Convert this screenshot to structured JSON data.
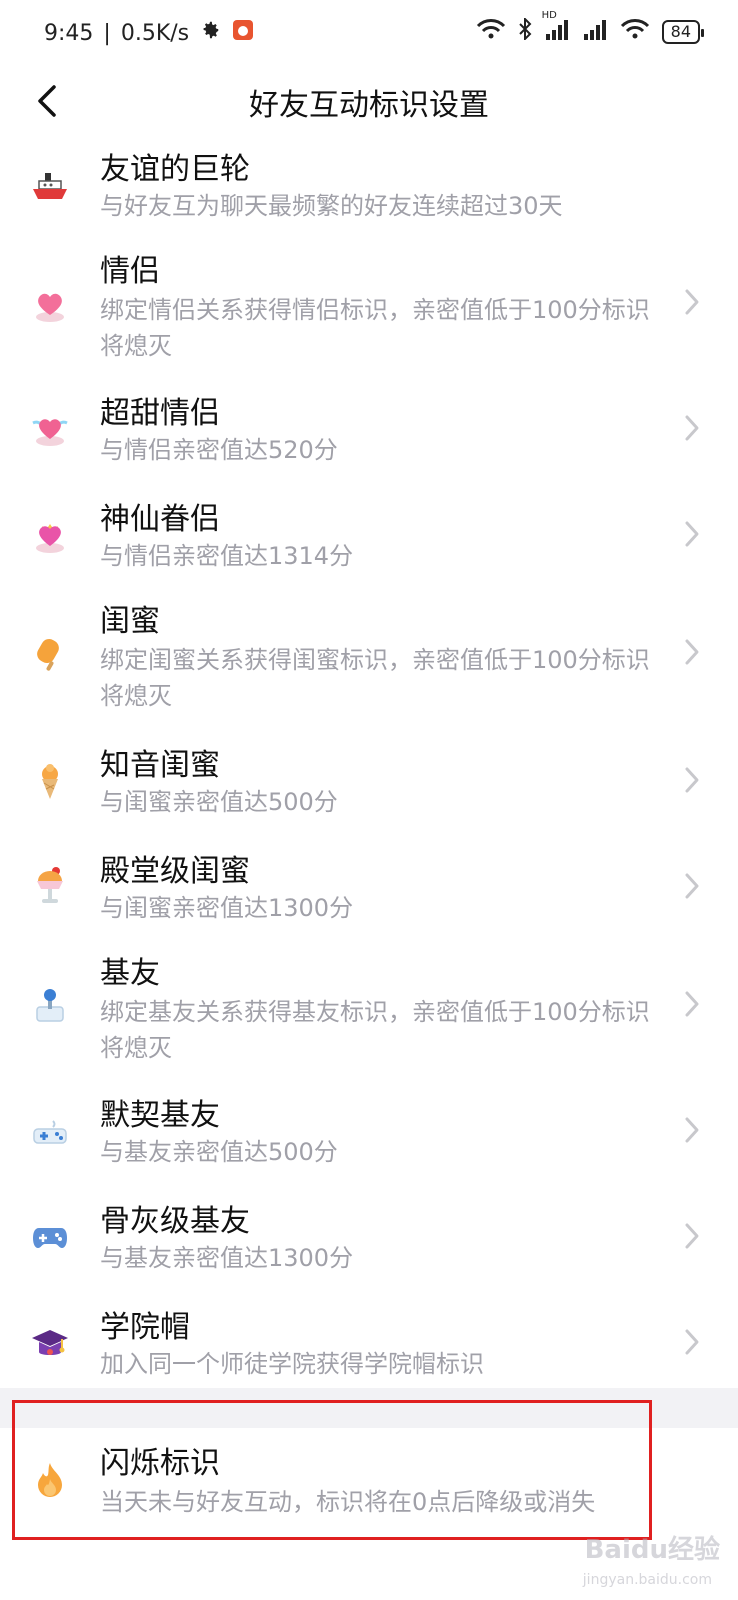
{
  "status": {
    "time": "9:45",
    "speed": "0.5K/s",
    "battery": "84",
    "hd_label": "HD"
  },
  "header": {
    "title": "好友互动标识设置"
  },
  "items": [
    {
      "title": "友谊的巨轮",
      "desc": "与好友互为聊天最频繁的好友连续超过30天",
      "icon": "ship-icon",
      "has_chevron": false
    },
    {
      "title": "情侣",
      "desc": "绑定情侣关系获得情侣标识，亲密值低于100分标识将熄灭",
      "icon": "heart-icon"
    },
    {
      "title": "超甜情侣",
      "desc": "与情侣亲密值达520分",
      "icon": "winged-heart-icon"
    },
    {
      "title": "神仙眷侣",
      "desc": "与情侣亲密值达1314分",
      "icon": "crowned-heart-icon"
    },
    {
      "title": "闺蜜",
      "desc": "绑定闺蜜关系获得闺蜜标识，亲密值低于100分标识将熄灭",
      "icon": "popsicle-icon"
    },
    {
      "title": "知音闺蜜",
      "desc": "与闺蜜亲密值达500分",
      "icon": "ice-cream-icon"
    },
    {
      "title": "殿堂级闺蜜",
      "desc": "与闺蜜亲密值达1300分",
      "icon": "sundae-icon"
    },
    {
      "title": "基友",
      "desc": "绑定基友关系获得基友标识，亲密值低于100分标识将熄灭",
      "icon": "joystick-icon"
    },
    {
      "title": "默契基友",
      "desc": "与基友亲密值达500分",
      "icon": "gamepad-icon"
    },
    {
      "title": "骨灰级基友",
      "desc": "与基友亲密值达1300分",
      "icon": "controller-icon"
    },
    {
      "title": "学院帽",
      "desc": "加入同一个师徒学院获得学院帽标识",
      "icon": "graduation-cap-icon"
    }
  ],
  "flash_item": {
    "title": "闪烁标识",
    "desc": "当天未与好友互动，标识将在0点后降级或消失",
    "icon": "flame-icon"
  },
  "watermark": {
    "main": "Baidu经验",
    "sub": "jingyan.baidu.com"
  }
}
